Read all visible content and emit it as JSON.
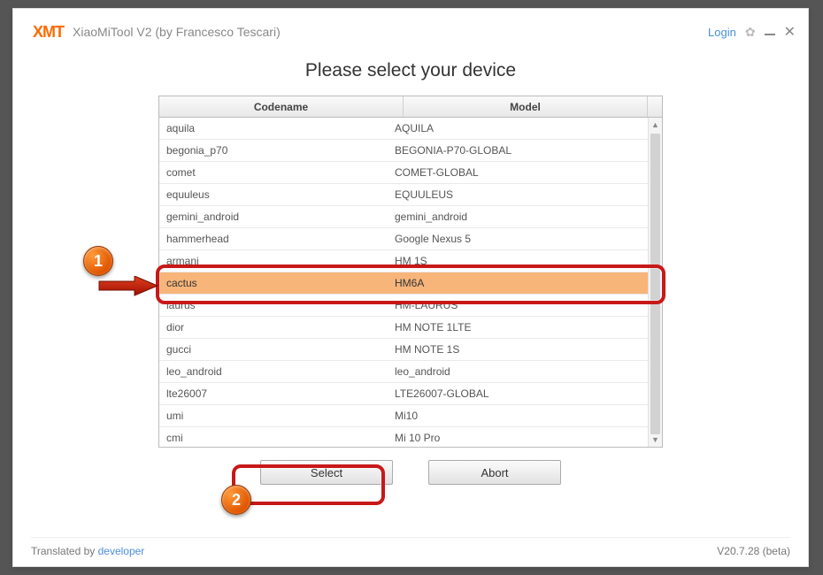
{
  "titlebar": {
    "logo_x": "X",
    "logo_m": "M",
    "logo_t": "T",
    "title": "XiaoMiTool V2 (by Francesco Tescari)",
    "login": "Login"
  },
  "heading": "Please select your device",
  "table": {
    "head_codename": "Codename",
    "head_model": "Model",
    "rows": [
      {
        "codename": "aquila",
        "model": "AQUILA"
      },
      {
        "codename": "begonia_p70",
        "model": "BEGONIA-P70-GLOBAL"
      },
      {
        "codename": "comet",
        "model": "COMET-GLOBAL"
      },
      {
        "codename": "equuleus",
        "model": "EQUULEUS"
      },
      {
        "codename": "gemini_android",
        "model": "gemini_android"
      },
      {
        "codename": "hammerhead",
        "model": "Google Nexus 5"
      },
      {
        "codename": "armani",
        "model": "HM 1S"
      },
      {
        "codename": "cactus",
        "model": "HM6A"
      },
      {
        "codename": "laurus",
        "model": "HM-LAURUS"
      },
      {
        "codename": "dior",
        "model": "HM NOTE 1LTE"
      },
      {
        "codename": "gucci",
        "model": "HM NOTE 1S"
      },
      {
        "codename": "leo_android",
        "model": "leo_android"
      },
      {
        "codename": "lte26007",
        "model": "LTE26007-GLOBAL"
      },
      {
        "codename": "umi",
        "model": "Mi10"
      },
      {
        "codename": "cmi",
        "model": "Mi 10 Pro"
      }
    ],
    "selected_index": 7
  },
  "buttons": {
    "select": "Select",
    "abort": "Abort"
  },
  "footer": {
    "translated_by": "Translated by ",
    "translator": "developer",
    "version": "V20.7.28 (beta)"
  },
  "annotations": {
    "marker1": "1",
    "marker2": "2"
  }
}
